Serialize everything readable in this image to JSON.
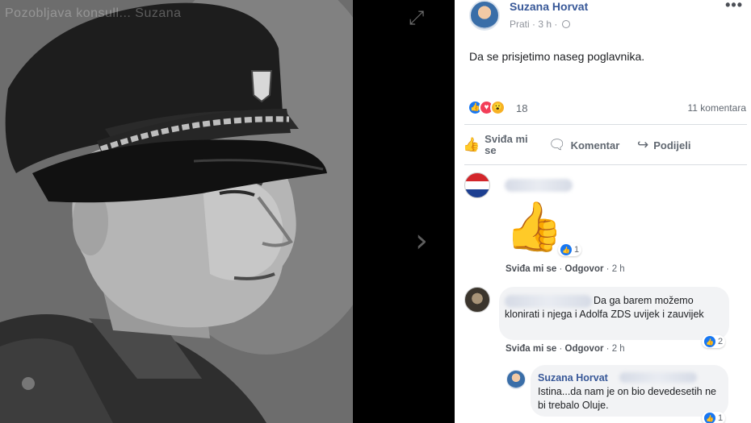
{
  "photo": {
    "watermark": "Pozobljava konsull... Suzana",
    "nav_top_icon": "expand-icon",
    "nav_next_icon": "chevron-right-icon"
  },
  "post": {
    "author": "Suzana Horvat",
    "follow_label": "Prati",
    "time": "3 h",
    "text": "Da se prisjetimo naseg poglavnika.",
    "more_label": "•••",
    "reaction_count": "18",
    "comment_count": "11 komentara",
    "actions": {
      "like": "Sviđa mi se",
      "comment": "Komentar",
      "share": "Podijeli"
    }
  },
  "comments": [
    {
      "reaction_count": "1",
      "like_label": "Sviđa mi se",
      "reply_label": "Odgovor",
      "time": "2 h"
    },
    {
      "text": "Da ga barem možemo klonirati i njega i Adolfa ZDS uvijek i zauvijek",
      "reaction_count": "2",
      "like_label": "Sviđa mi se",
      "reply_label": "Odgovor",
      "time": "2 h"
    },
    {
      "author": "Suzana Horvat",
      "text": "Istina...da nam je on bio devedesetih ne bi trebalo Oluje.",
      "reaction_count": "1"
    }
  ],
  "colors": {
    "link_blue": "#385898",
    "like_blue": "#1877f2",
    "love_red": "#f33e58",
    "wow_yellow": "#f7b125",
    "bubble_gray": "#f2f3f5"
  }
}
